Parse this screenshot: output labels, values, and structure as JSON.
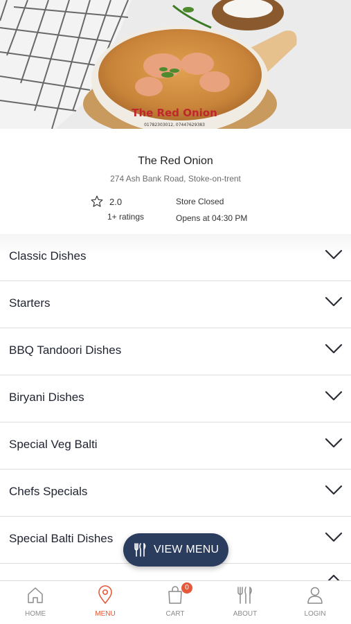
{
  "hero": {
    "logo_text": "The Red Onion",
    "logo_phone": "01782303012, 07447629383"
  },
  "store": {
    "name": "The Red Onion",
    "address": "274 Ash Bank Road, Stoke-on-trent",
    "rating": "2.0",
    "ratings_count": "1+ ratings",
    "status": "Store Closed",
    "opens_at": "Opens at 04:30 PM"
  },
  "categories": [
    {
      "label": "Classic Dishes"
    },
    {
      "label": "Starters"
    },
    {
      "label": "BBQ Tandoori Dishes"
    },
    {
      "label": "Biryani Dishes"
    },
    {
      "label": "Special Veg Balti"
    },
    {
      "label": "Chefs Specials"
    },
    {
      "label": "Special Balti Dishes"
    }
  ],
  "view_menu": {
    "label": "VIEW MENU"
  },
  "nav": {
    "home": "HOME",
    "menu": "MENU",
    "cart": "CART",
    "cart_count": "0",
    "about": "ABOUT",
    "login": "LOGIN"
  },
  "colors": {
    "accent": "#e4593a",
    "button_bg": "#2b3d5e",
    "divider": "#dcdcdc"
  }
}
